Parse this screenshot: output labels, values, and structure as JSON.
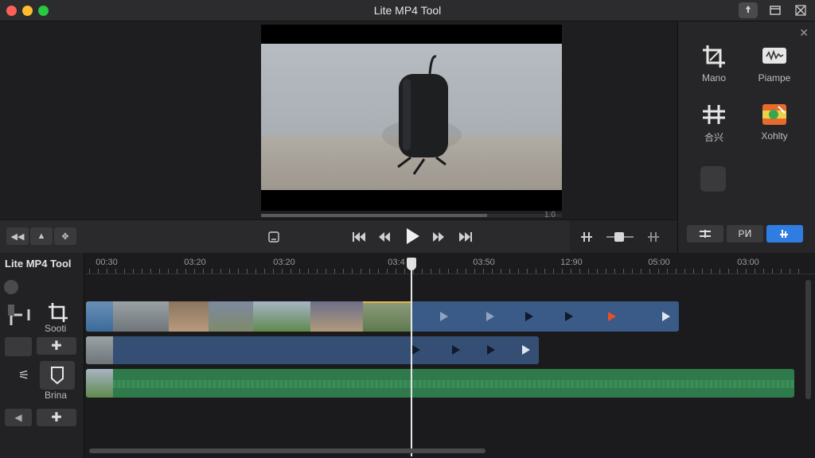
{
  "window": {
    "title": "Lite MP4 Tool"
  },
  "viewer": {
    "timecode": "1:0"
  },
  "inspector": {
    "tools": [
      {
        "label": "Mano",
        "icon": "crop-icon"
      },
      {
        "label": "Pіampe",
        "icon": "waveform-icon"
      },
      {
        "label": "合兴",
        "icon": "split-icon"
      },
      {
        "label": "Xohlty",
        "icon": "color-icon"
      }
    ],
    "tabs": [
      {
        "label": "",
        "icon": "adjust-icon"
      },
      {
        "label": "PͶ"
      },
      {
        "label": "",
        "icon": "audio-icon"
      }
    ]
  },
  "timeline": {
    "title": "Lite MP4 Tool",
    "ruler_labels": [
      "00:30",
      "03:20",
      "03:20",
      "03:4",
      "03:50",
      "12:90",
      "05:00",
      "03:00"
    ],
    "side_labels": {
      "tool_a": "Sooti",
      "tool_b": "Brina"
    }
  },
  "colors": {
    "accent": "#2f7de1",
    "video_track": "#3a5a87",
    "audio_track": "#2e7a4b",
    "marker": "#e2512a"
  }
}
